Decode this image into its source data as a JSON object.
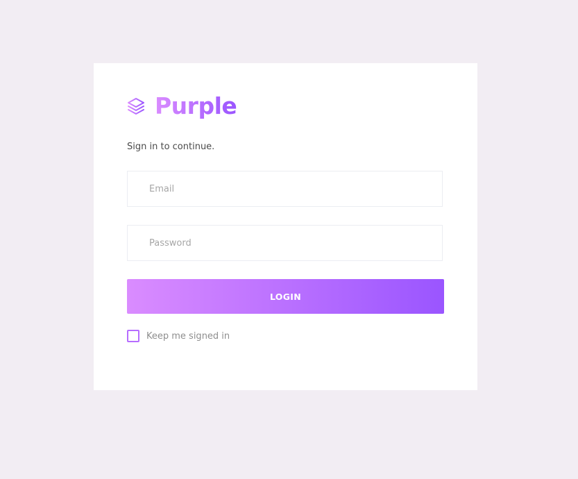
{
  "brand": {
    "name": "Purple",
    "icon": "layers-icon",
    "gradient_start": "#da8cff",
    "gradient_end": "#9a55ff"
  },
  "login_form": {
    "subtitle": "Sign in to continue.",
    "email": {
      "placeholder": "Email",
      "value": ""
    },
    "password": {
      "placeholder": "Password",
      "value": ""
    },
    "submit_label": "LOGIN",
    "remember": {
      "label": "Keep me signed in",
      "checked": false
    }
  },
  "colors": {
    "page_background": "#f2edf3",
    "card_background": "#ffffff",
    "accent": "#b66dff"
  }
}
